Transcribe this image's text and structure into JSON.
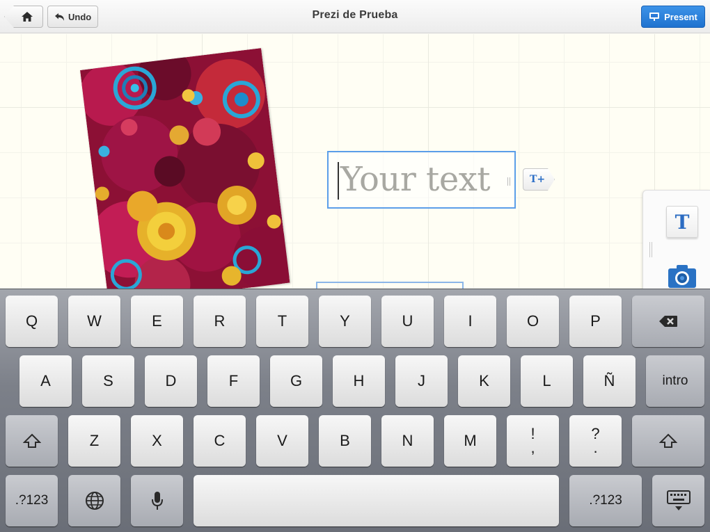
{
  "topbar": {
    "undo_label": "Undo",
    "title": "Prezi de Prueba",
    "present_label": "Present",
    "icons": {
      "home": "home-icon",
      "undo": "undo-arrow-icon",
      "present": "present-screen-icon"
    }
  },
  "canvas": {
    "textbox": {
      "placeholder": "Your text"
    },
    "add_text_button": "T+",
    "palette": {
      "text_tool": "T",
      "icons": {
        "text": "text-tool-icon",
        "camera": "camera-icon"
      }
    }
  },
  "keyboard": {
    "rows": [
      [
        "Q",
        "W",
        "E",
        "R",
        "T",
        "Y",
        "U",
        "I",
        "O",
        "P"
      ],
      [
        "A",
        "S",
        "D",
        "F",
        "G",
        "H",
        "J",
        "K",
        "L",
        "Ñ"
      ],
      [
        "Z",
        "X",
        "C",
        "V",
        "B",
        "N",
        "M"
      ]
    ],
    "punct_keys": [
      {
        "top": "!",
        "bottom": ","
      },
      {
        "top": "?",
        "bottom": "."
      }
    ],
    "return_label": "intro",
    "numbers_label": ".?123",
    "icons": {
      "backspace": "backspace-icon",
      "shift": "shift-icon",
      "globe": "globe-icon",
      "microphone": "microphone-icon",
      "hide_keyboard": "hide-keyboard-icon"
    }
  },
  "colors": {
    "accent": "#2a7ad8",
    "selection": "#5b9ee9",
    "text_tool": "#2c6cc2"
  }
}
